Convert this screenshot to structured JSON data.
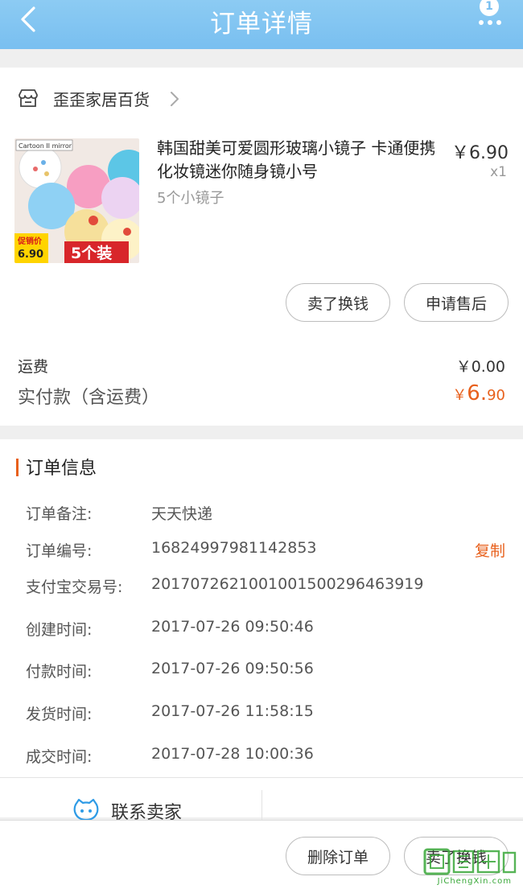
{
  "nav": {
    "title": "订单详情",
    "badge": "1"
  },
  "shop": {
    "name": "歪歪家居百货"
  },
  "product": {
    "title": "韩国甜美可爱圆形玻璃小镜子 卡通便携化妆镜迷你随身镜小号",
    "variant": "5个小镜子",
    "price": "￥6.90",
    "qty": "x1",
    "thumb_caption": "Cartoon II mirror",
    "thumb_promo_label": "促销价",
    "thumb_promo_price": "6.90",
    "thumb_pack": "5个装"
  },
  "actions": {
    "sell": "卖了换钱",
    "aftersale": "申请售后"
  },
  "fees": {
    "shipping_label": "运费",
    "shipping_value": "￥0.00",
    "paid_label": "实付款（含运费）",
    "paid_currency": "￥",
    "paid_int": "6.",
    "paid_dec": "90"
  },
  "order_info": {
    "title": "订单信息",
    "copy": "复制",
    "rows": [
      {
        "label": "订单备注:",
        "value": "天天快递"
      },
      {
        "label": "订单编号:",
        "value": "16824997981142853"
      },
      {
        "label": "支付宝交易号:",
        "value": "2017072621001001500296463919"
      },
      {
        "label": "创建时间:",
        "value": "2017-07-26 09:50:46"
      },
      {
        "label": "付款时间:",
        "value": "2017-07-26 09:50:56"
      },
      {
        "label": "发货时间:",
        "value": "2017-07-26 11:58:15"
      },
      {
        "label": "成交时间:",
        "value": "2017-07-28 10:00:36"
      }
    ]
  },
  "contact": {
    "label": "联系卖家"
  },
  "bottom": {
    "delete": "删除订单",
    "sell": "卖了换钱"
  },
  "watermark": {
    "url": "JiChengXin.com"
  },
  "colors": {
    "nav": "#79bff0",
    "accent": "#e8601c",
    "background": "#efefef"
  }
}
